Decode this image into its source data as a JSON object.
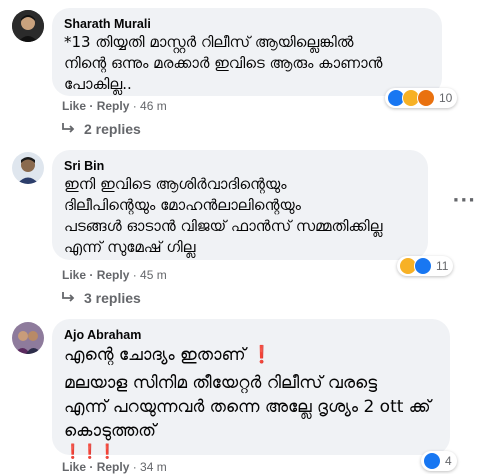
{
  "comments": [
    {
      "author": "Sharath Murali",
      "text": "*13 തിയ്യതി മാസ്റ്റർ റിലീസ് ആയില്ലെങ്കിൽ\nനിന്റെ ഒന്നും മരക്കാർ ഇവിടെ ആരും കാണാൻ\nപോകില്ല..",
      "like_label": "Like",
      "reply_label": "Reply",
      "time": "46 m",
      "reaction_count": "10",
      "replies_label": "2 replies"
    },
    {
      "author": "Sri Bin",
      "text": "ഇനി ഇവിടെ ആശിർവാദിന്റെയും\nദിലീപിന്റെയും മോഹൻലാലിന്റെയും\nപടങ്ങൾ ഓടാൻ വിജയ് ഫാൻസ് സമ്മതിക്കില്ല\nഎന്ന് സുമേഷ് ഗില്ല",
      "like_label": "Like",
      "reply_label": "Reply",
      "time": "45 m",
      "reaction_count": "11",
      "replies_label": "3 replies"
    },
    {
      "author": "Ajo Abraham",
      "line1": "എന്റെ ചോദ്യം ഇതാണ്",
      "line2": "മലയാള സിനിമ തീയേറ്റർ റിലീസ് വരട്ടെ\nഎന്ന് പറയുന്നവർ തന്നെ അല്ലേ ദൃശ്യം 2 ott ക്ക്\nകൊടുത്തത്",
      "exclaim": "❗",
      "exclaims": "❗❗❗",
      "like_label": "Like",
      "reply_label": "Reply",
      "time": "34 m",
      "reaction_count": "4"
    }
  ],
  "separator": " · ",
  "colors": {
    "bubble": "#f0f2f5",
    "meta": "#65676b",
    "like_blue": "#1877f2",
    "haha_yellow": "#f7b125",
    "angry_orange": "#e9710f",
    "exclaim_red": "#e41e3f"
  },
  "icons": [
    "reply-arrow-icon",
    "like-reaction-icon",
    "haha-reaction-icon",
    "angry-reaction-icon",
    "more-options-icon"
  ]
}
